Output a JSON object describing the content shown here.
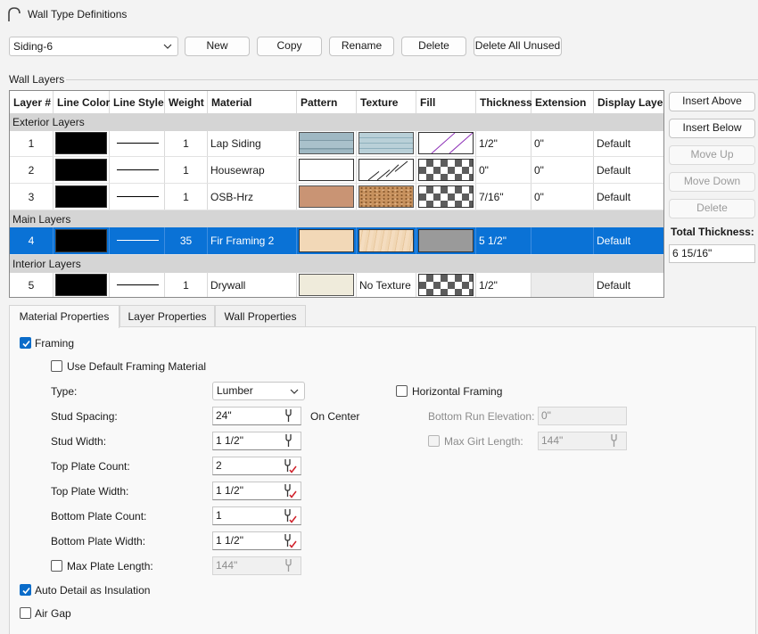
{
  "window": {
    "title": "Wall Type Definitions"
  },
  "toolbar": {
    "wall_type": "Siding-6",
    "new_label": "New",
    "copy_label": "Copy",
    "rename_label": "Rename",
    "delete_label": "Delete",
    "delete_all_unused_label": "Delete All Unused"
  },
  "wall_layers": {
    "group_label": "Wall Layers",
    "columns": [
      "Layer #",
      "Line Color",
      "Line Style",
      "Weight",
      "Material",
      "Pattern",
      "Texture",
      "Fill",
      "Thickness",
      "Extension",
      "Display Layer"
    ],
    "sections": {
      "exterior": "Exterior Layers",
      "main": "Main Layers",
      "interior": "Interior Layers"
    },
    "rows": [
      {
        "layer": "1",
        "weight": "1",
        "material": "Lap Siding",
        "thickness": "1/2\"",
        "extension": "0\"",
        "display_layer": "Default",
        "line_color": "#000000",
        "pattern_color": "#9fb8c3",
        "texture_icon": "lap-siding-texture",
        "fill_icon": "diagonal-line-fill"
      },
      {
        "layer": "2",
        "weight": "1",
        "material": "Housewrap",
        "thickness": "0\"",
        "extension": "0\"",
        "display_layer": "Default",
        "line_color": "#000000",
        "pattern_color": "#ffffff",
        "texture_icon": "housewrap-texture",
        "fill_icon": "checker-fill"
      },
      {
        "layer": "3",
        "weight": "1",
        "material": "OSB-Hrz",
        "thickness": "7/16\"",
        "extension": "0\"",
        "display_layer": "Default",
        "line_color": "#000000",
        "pattern_color": "#c99474",
        "texture_icon": "osb-texture",
        "fill_icon": "checker-fill"
      },
      {
        "layer": "4",
        "weight": "35",
        "material": "Fir Framing 2",
        "thickness": "5 1/2\"",
        "extension": "",
        "display_layer": "Default",
        "line_color": "#000000",
        "pattern_color": "#f2d8b7",
        "texture_icon": "fir-wood-texture",
        "fill_icon": "gray-fill",
        "selected": true
      },
      {
        "layer": "5",
        "weight": "1",
        "material": "Drywall",
        "thickness": "1/2\"",
        "extension": "",
        "display_layer": "Default",
        "line_color": "#000000",
        "pattern_color": "#efebdb",
        "texture_text": "No Texture",
        "fill_icon": "checker-fill"
      }
    ]
  },
  "side_buttons": {
    "insert_above": "Insert Above",
    "insert_below": "Insert Below",
    "move_up": "Move Up",
    "move_down": "Move Down",
    "delete": "Delete"
  },
  "total_thickness": {
    "label": "Total Thickness:",
    "value": "6 15/16\""
  },
  "tabs": [
    "Material Properties",
    "Layer Properties",
    "Wall Properties"
  ],
  "material_properties": {
    "framing_label": "Framing",
    "use_default_label": "Use Default Framing Material",
    "type_label": "Type:",
    "type_value": "Lumber",
    "horizontal_framing_label": "Horizontal Framing",
    "stud_spacing_label": "Stud Spacing:",
    "stud_spacing_value": "24\"",
    "on_center_label": "On Center",
    "bottom_run_elevation_label": "Bottom Run Elevation:",
    "bottom_run_elevation_value": "0\"",
    "stud_width_label": "Stud Width:",
    "stud_width_value": "1 1/2\"",
    "max_girt_length_label": "Max Girt Length:",
    "max_girt_length_value": "144\"",
    "top_plate_count_label": "Top Plate Count:",
    "top_plate_count_value": "2",
    "top_plate_width_label": "Top Plate Width:",
    "top_plate_width_value": "1 1/2\"",
    "bottom_plate_count_label": "Bottom Plate Count:",
    "bottom_plate_count_value": "1",
    "bottom_plate_width_label": "Bottom Plate Width:",
    "bottom_plate_width_value": "1 1/2\"",
    "max_plate_length_label": "Max Plate Length:",
    "max_plate_length_value": "144\"",
    "auto_detail_label": "Auto Detail as Insulation",
    "air_gap_label": "Air Gap"
  },
  "colors": {
    "accent": "#0a72d6",
    "section_bg": "#d5d5d5"
  }
}
